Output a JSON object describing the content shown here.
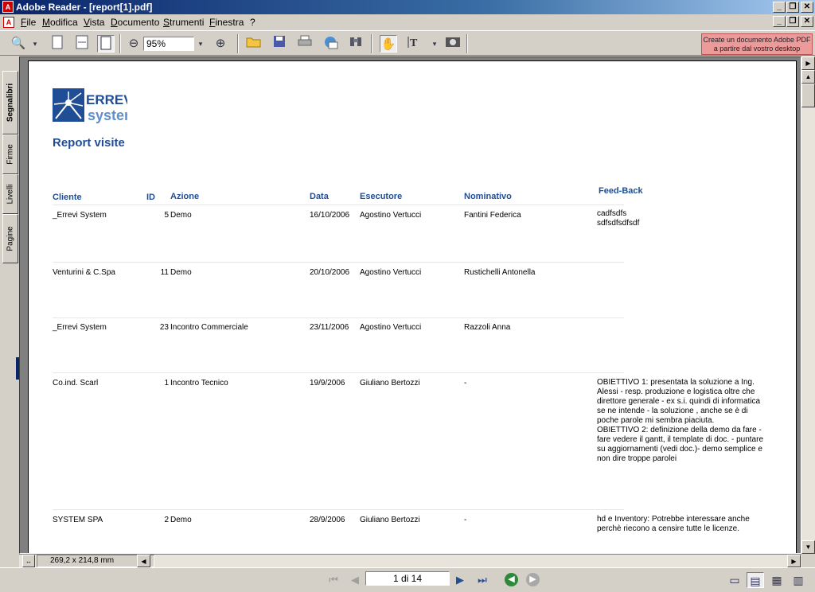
{
  "window": {
    "title": "Adobe Reader - [report[1].pdf]",
    "minimize": "_",
    "maximize": "❐",
    "close": "✕"
  },
  "menu": [
    "File",
    "Modifica",
    "Vista",
    "Documento",
    "Strumenti",
    "Finestra",
    "?"
  ],
  "toolbar": {
    "zoom_value": "95%",
    "promo_label": "Create un documento Adobe PDF a partire dal vostro desktop",
    "icons": [
      "zoom-icon",
      "page-icon",
      "fit-width-icon",
      "fit-page-icon",
      "zoom-out-icon",
      "zoom-in-icon",
      "open-folder-icon",
      "save-icon",
      "print-icon",
      "email-icon",
      "search-icon",
      "hand-icon",
      "select-text-icon",
      "snapshot-icon"
    ]
  },
  "nav_tabs": [
    "Segnalibri",
    "Firme",
    "Livelli",
    "Pagine"
  ],
  "report": {
    "logo_text": "ERREVI system",
    "title": "Report visite",
    "headers": {
      "cliente": "Cliente",
      "id": "ID",
      "azione": "Azione",
      "data": "Data",
      "esecutore": "Esecutore",
      "nominativo": "Nominativo",
      "feedback": "Feed-Back"
    },
    "rows": [
      {
        "cliente": "_Errevi System",
        "id": "5",
        "azione": "Demo",
        "data": "16/10/2006",
        "esecutore": "Agostino Vertucci",
        "nominativo": "Fantini Federica",
        "feedback": "cadfsdfs\nsdfsdfsdfsdf"
      },
      {
        "cliente": "Venturini & C.Spa",
        "id": "11",
        "azione": "Demo",
        "data": "20/10/2006",
        "esecutore": "Agostino Vertucci",
        "nominativo": "Rustichelli Antonella",
        "feedback": ""
      },
      {
        "cliente": "_Errevi System",
        "id": "23",
        "azione": "Incontro Commerciale",
        "data": "23/11/2006",
        "esecutore": "Agostino Vertucci",
        "nominativo": "Razzoli Anna",
        "feedback": ""
      },
      {
        "cliente": "Co.ind. Scarl",
        "id": "1",
        "azione": "Incontro Tecnico",
        "data": "19/9/2006",
        "esecutore": "Giuliano Bertozzi",
        "nominativo": "-",
        "feedback": "OBIETTIVO 1: presentata la soluzione a Ing. Alessi - resp. produzione e logistica oltre che direttore generale - ex s.i. quindi di informatica se ne intende - la soluzione , anche se è di poche parole mi sembra piaciuta.\nOBIETTIVO 2: definizione della demo da fare -  fare vedere il gantt, il template di doc. - puntare su aggiornamenti (vedi doc.)- demo semplice e non dire troppe parolei"
      },
      {
        "cliente": "SYSTEM SPA",
        "id": "2",
        "azione": "Demo",
        "data": "28/9/2006",
        "esecutore": "Giuliano Bertozzi",
        "nominativo": "-",
        "feedback": "hd e Inventory: Potrebbe interessare anche perchè riecono a censire tutte le licenze."
      }
    ]
  },
  "status": {
    "page_size": "269,2 x 214,8 mm",
    "page_indicator": "1 di 14"
  },
  "colors": {
    "accent": "#1f4e97",
    "titlebar": "#0a246a"
  }
}
